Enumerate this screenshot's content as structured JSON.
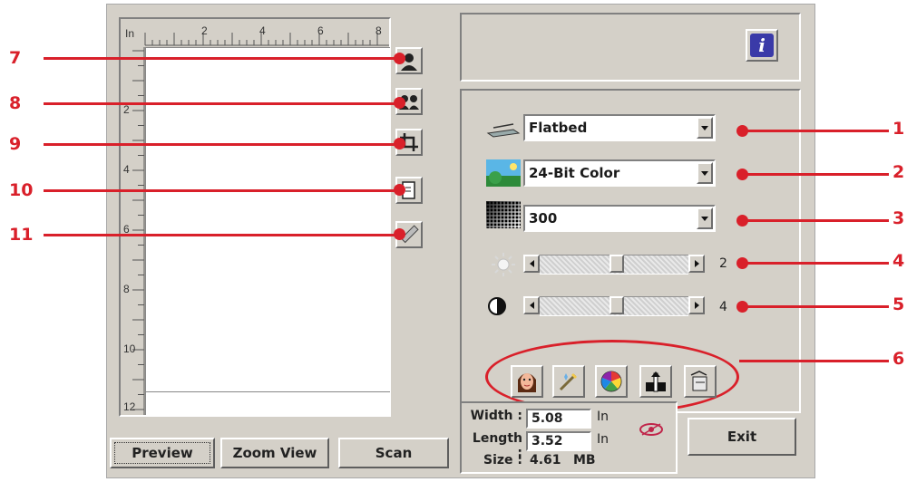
{
  "ruler": {
    "unit": "In",
    "top_ticks": [
      "2",
      "4",
      "6",
      "8"
    ],
    "left_ticks": [
      "2",
      "4",
      "6",
      "8",
      "10",
      "12"
    ]
  },
  "source": {
    "selected": "Flatbed",
    "icon": "flatbed-scanner-icon"
  },
  "color_mode": {
    "selected": "24-Bit Color",
    "icon": "color-image-icon"
  },
  "resolution": {
    "selected": "300",
    "icon": "halftone-icon"
  },
  "brightness": {
    "value": "2",
    "level": 0.52,
    "icon": "brightness-sun-icon"
  },
  "contrast": {
    "value": "4",
    "level": 0.52,
    "icon": "contrast-icon"
  },
  "dimensions": {
    "width_label": "Width :",
    "width_value": "5.08",
    "width_unit": "In",
    "length_label": "Length :",
    "length_value": "3.52",
    "length_unit": "In",
    "size_label": "Size :",
    "size_value": "4.61",
    "size_unit": "MB"
  },
  "buttons": {
    "preview": "Preview",
    "zoom_view": "Zoom View",
    "scan": "Scan",
    "exit": "Exit"
  },
  "callouts": {
    "left": [
      "7",
      "8",
      "9",
      "10",
      "11"
    ],
    "right": [
      "1",
      "2",
      "3",
      "4",
      "5",
      "6"
    ]
  },
  "colors": {
    "callout": "#d9202a",
    "dialog_bg": "#d4d0c8",
    "info_icon": "#3a3aa8"
  }
}
